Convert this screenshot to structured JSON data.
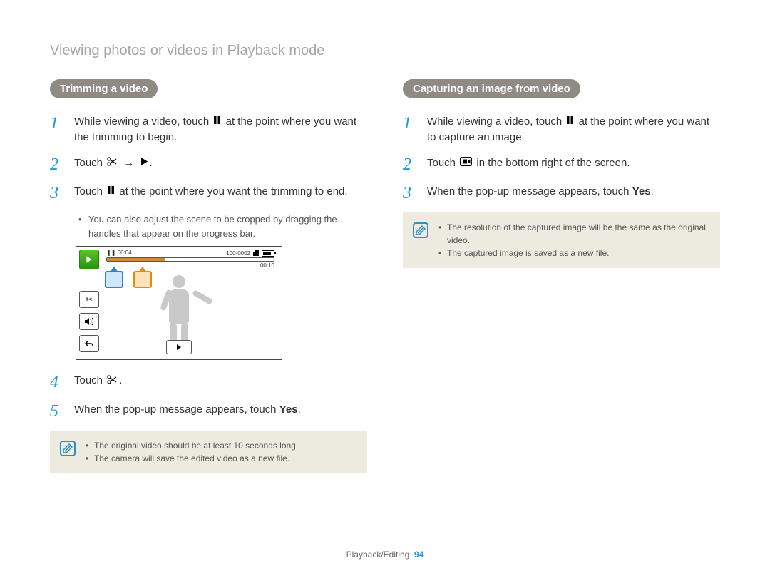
{
  "page_title": "Viewing photos or videos in Playback mode",
  "left": {
    "heading": "Trimming a video",
    "steps": [
      {
        "num": "1",
        "parts": [
          "While viewing a video, touch ",
          "PAUSE",
          " at the point where you want the trimming to begin."
        ]
      },
      {
        "num": "2",
        "parts": [
          "Touch ",
          "SCISSORS",
          " ",
          "ARROW",
          " ",
          "PLAY",
          "."
        ]
      },
      {
        "num": "3",
        "parts": [
          "Touch ",
          "PAUSE",
          " at the point where you want the trimming to end."
        ]
      },
      {
        "num": "4",
        "parts": [
          "Touch ",
          "SCISSORS",
          "."
        ]
      },
      {
        "num": "5",
        "parts": [
          "When the pop-up message appears, touch ",
          "BOLD:Yes",
          "."
        ]
      }
    ],
    "sub3": "You can also adjust the scene to be cropped by dragging the handles that appear on the progress bar.",
    "note1": "The original video should be at least 10 seconds long.",
    "note2": "The camera will save the edited video as a new file."
  },
  "right": {
    "heading": "Capturing an image from video",
    "steps": [
      {
        "num": "1",
        "parts": [
          "While viewing a video, touch ",
          "PAUSE",
          " at the point where you want to capture an image."
        ]
      },
      {
        "num": "2",
        "parts": [
          "Touch ",
          "CAPTURE",
          " in the bottom right of the screen."
        ]
      },
      {
        "num": "3",
        "parts": [
          "When the pop-up message appears, touch ",
          "BOLD:Yes",
          "."
        ]
      }
    ],
    "note1": "The resolution of the captured image will be the same as the original video.",
    "note2": "The captured image is saved as a new file."
  },
  "screen": {
    "time_cur": "00:04",
    "time_tot": "00:10",
    "file_no": "100-0002"
  },
  "footer": {
    "section": "Playback/Editing",
    "page": "94"
  }
}
